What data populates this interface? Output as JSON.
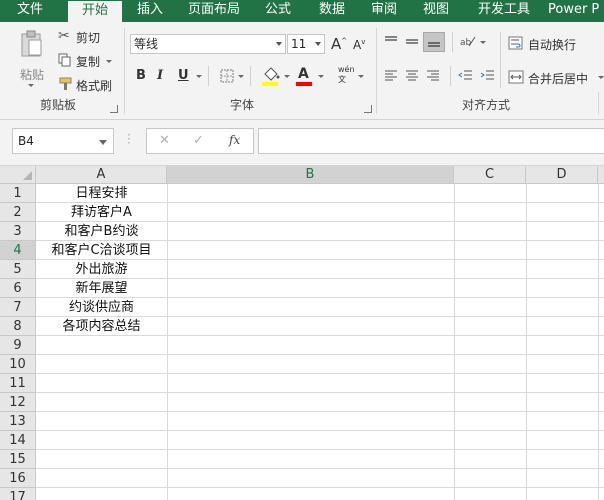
{
  "tabs": [
    {
      "label": "文件"
    },
    {
      "label": "开始"
    },
    {
      "label": "插入"
    },
    {
      "label": "页面布局"
    },
    {
      "label": "公式"
    },
    {
      "label": "数据"
    },
    {
      "label": "审阅"
    },
    {
      "label": "视图"
    },
    {
      "label": "开发工具"
    },
    {
      "label": "Power P"
    }
  ],
  "ribbon": {
    "clipboard": {
      "paste": "粘贴",
      "cut": "剪切",
      "copy": "复制",
      "format_painter": "格式刷",
      "group_label": "剪贴板"
    },
    "font": {
      "font_name": "等线",
      "font_size": "11",
      "bold": "B",
      "italic": "I",
      "underline": "U",
      "group_label": "字体"
    },
    "alignment": {
      "wrap_text": "自动换行",
      "merge_center": "合并后居中",
      "group_label": "对齐方式"
    }
  },
  "formula_bar": {
    "name_box": "B4",
    "cancel_symbol": "✕",
    "enter_symbol": "✓",
    "fx_symbol": "fx",
    "content": ""
  },
  "sheet": {
    "columns": [
      "A",
      "B",
      "C",
      "D"
    ],
    "rows": [
      "1",
      "2",
      "3",
      "4",
      "5",
      "6",
      "7",
      "8",
      "9",
      "10",
      "11",
      "12",
      "13",
      "14",
      "15",
      "16",
      "17"
    ],
    "columnA": [
      "日程安排",
      "拜访客户A",
      "和客户B约谈",
      "和客户C洽谈项目",
      "外出旅游",
      "新年展望",
      "约谈供应商",
      "各项内容总结"
    ]
  },
  "colors": {
    "accent": "#217346",
    "ribbon_bg": "#f3f3f3",
    "header_bg": "#e6e6e6",
    "gridline": "#dadada",
    "font_color_bar": "#ff0000",
    "highlight_bar": "#ffff00"
  }
}
